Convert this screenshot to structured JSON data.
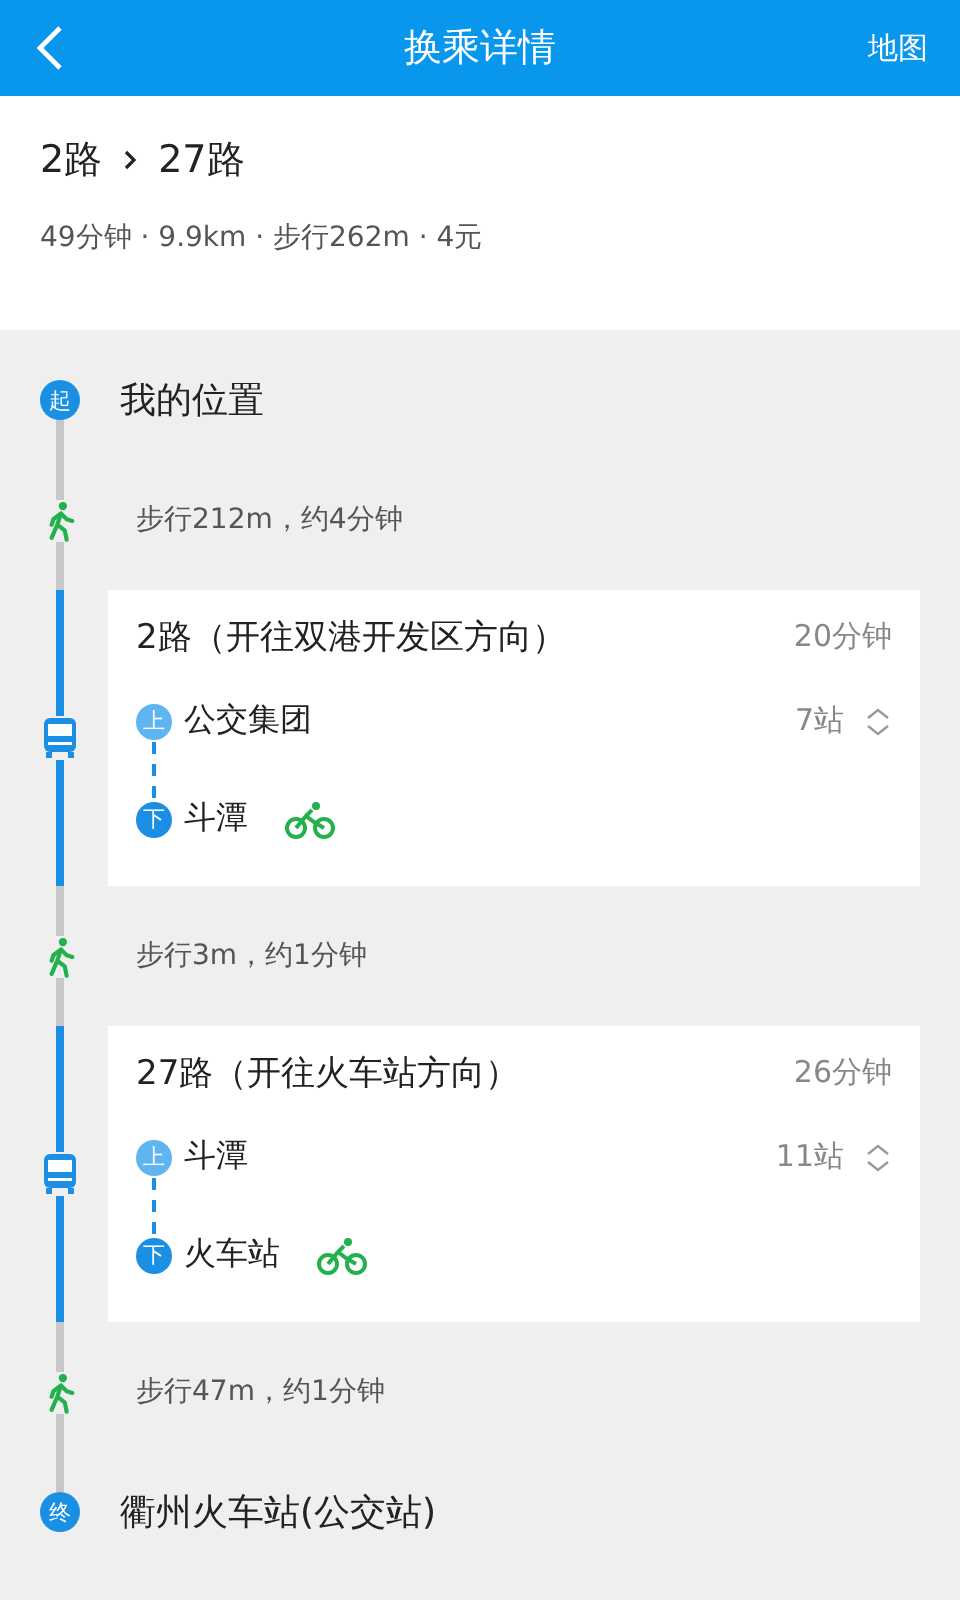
{
  "header": {
    "title": "换乘详情",
    "action": "地图"
  },
  "summary": {
    "routes": [
      "2路",
      "27路"
    ],
    "info": "49分钟 · 9.9km · 步行262m · 4元"
  },
  "steps": [
    {
      "kind": "start",
      "badge": "起",
      "text": "我的位置"
    },
    {
      "kind": "walk",
      "text": "步行212m，约4分钟"
    },
    {
      "kind": "bus",
      "line": "2路（开往双港开发区方向）",
      "duration": "20分钟",
      "board": {
        "badge": "上",
        "name": "公交集团"
      },
      "stops": "7站",
      "alight": {
        "badge": "下",
        "name": "斗潭"
      }
    },
    {
      "kind": "walk",
      "text": "步行3m，约1分钟"
    },
    {
      "kind": "bus",
      "line": "27路（开往火车站方向）",
      "duration": "26分钟",
      "board": {
        "badge": "上",
        "name": "斗潭"
      },
      "stops": "11站",
      "alight": {
        "badge": "下",
        "name": "火车站"
      }
    },
    {
      "kind": "walk",
      "text": "步行47m，约1分钟"
    },
    {
      "kind": "end",
      "badge": "终",
      "text": "衢州火车站(公交站)"
    }
  ]
}
